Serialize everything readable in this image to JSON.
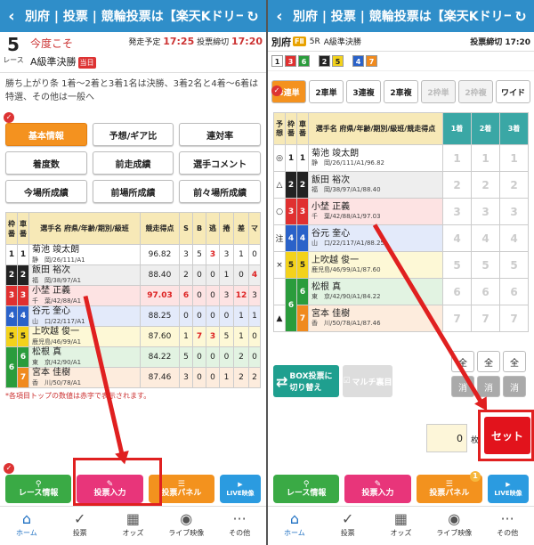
{
  "header": {
    "title": "別府 | 投票 | 競輪投票は【楽天Kドリー…"
  },
  "race": {
    "number": "5",
    "number_label": "レース",
    "name": "今度こそ",
    "grade": "A級準決勝",
    "grade_badge": "当日",
    "start_label": "発走予定",
    "start_time": "17:25",
    "close_label": "投票締切",
    "close_time": "17:20"
  },
  "conditions": "勝ち上がり条 1着〜2着と3着1名は決勝、3着2名と4着〜6着は特選、その他は一般へ",
  "tabs": [
    "基本情報",
    "予想/ギア比",
    "連対率",
    "着度数",
    "前走成績",
    "選手コメント",
    "今場所成績",
    "前場所成績",
    "前々場所成績"
  ],
  "left_table": {
    "headers": [
      "枠番",
      "車番",
      "選手名\n府県/年齢/期別/級班",
      "競走得点",
      "S",
      "B",
      "逃",
      "捲",
      "差",
      "マ"
    ],
    "rows": [
      {
        "frame": "1",
        "car": "1",
        "name": "菊池 竣太朗",
        "info": "静　岡/26/111/A1",
        "score": "96.82",
        "s": "3",
        "b": "5",
        "n": "3",
        "m": "3",
        "sa": "1",
        "ma": "0"
      },
      {
        "frame": "2",
        "car": "2",
        "name": "飯田 裕次",
        "info": "福　岡/38/97/A1",
        "score": "88.40",
        "s": "2",
        "b": "0",
        "n": "0",
        "m": "1",
        "sa": "0",
        "ma": "4"
      },
      {
        "frame": "3",
        "car": "3",
        "name": "小埜 正義",
        "info": "千　葉/42/88/A1",
        "score": "97.03",
        "s": "6",
        "b": "0",
        "n": "0",
        "m": "3",
        "sa": "12",
        "ma": "3"
      },
      {
        "frame": "4",
        "car": "4",
        "name": "谷元 奎心",
        "info": "山　口/22/117/A1",
        "score": "88.25",
        "s": "0",
        "b": "0",
        "n": "0",
        "m": "0",
        "sa": "1",
        "ma": "1"
      },
      {
        "frame": "5",
        "car": "5",
        "name": "上吹越 俊一",
        "info": "鹿児島/46/99/A1",
        "score": "87.60",
        "s": "1",
        "b": "7",
        "n": "3",
        "m": "5",
        "sa": "1",
        "ma": "0"
      },
      {
        "frame": "6",
        "car": "6",
        "name": "松根 真",
        "info": "東　京/42/90/A1",
        "score": "84.22",
        "s": "5",
        "b": "0",
        "n": "0",
        "m": "0",
        "sa": "2",
        "ma": "0"
      },
      {
        "frame": "6",
        "car": "7",
        "name": "宮本 佳樹",
        "info": "香　川/50/78/A1",
        "score": "87.46",
        "s": "3",
        "b": "0",
        "n": "0",
        "m": "1",
        "sa": "2",
        "ma": "2"
      }
    ]
  },
  "note": "*各項目トップの数値は赤字で表示されます。",
  "footer_buttons": [
    "レース情報",
    "投票入力",
    "投票パネル",
    "LIVE映像"
  ],
  "nav": [
    "ホーム",
    "投票",
    "オッズ",
    "ライブ映像",
    "その他"
  ],
  "nav_icons": [
    "home-icon",
    "vote-icon",
    "odds-icon",
    "live-icon",
    "more-icon"
  ],
  "right": {
    "venue": "別府",
    "venue_badge": "FⅡ",
    "race_label": "5R",
    "grade": "A級準決勝",
    "close_label": "投票締切",
    "close_time": "17:20",
    "lines": [
      "1",
      "3",
      "6",
      "2",
      "5",
      "4",
      "7"
    ],
    "bet_types": [
      "3連単",
      "2車単",
      "3連複",
      "2車複",
      "2枠単",
      "2枠複",
      "ワイド"
    ],
    "headers": [
      "予想",
      "枠番",
      "車番",
      "選手名\n府県/年齢/期別/級班/競走得点",
      "1着",
      "2着",
      "3着"
    ],
    "rows": [
      {
        "mark": "◎",
        "frame": "1",
        "car": "1",
        "name": "菊池 竣太朗",
        "info": "静　岡/26/111/A1/96.82"
      },
      {
        "mark": "△",
        "frame": "2",
        "car": "2",
        "name": "飯田 裕次",
        "info": "福　岡/38/97/A1/88.40"
      },
      {
        "mark": "○",
        "frame": "3",
        "car": "3",
        "name": "小埜 正義",
        "info": "千　葉/42/88/A1/97.03"
      },
      {
        "mark": "注",
        "frame": "4",
        "car": "4",
        "name": "谷元 奎心",
        "info": "山　口/22/117/A1/88.25"
      },
      {
        "mark": "×",
        "frame": "5",
        "car": "5",
        "name": "上吹越 俊一",
        "info": "鹿児島/46/99/A1/87.60"
      },
      {
        "mark": "",
        "frame": "6",
        "car": "6",
        "name": "松根 真",
        "info": "東　京/42/90/A1/84.22"
      },
      {
        "mark": "▲",
        "frame": "6",
        "car": "7",
        "name": "宮本 佳樹",
        "info": "香　川/50/78/A1/87.46"
      }
    ],
    "all_label": "全",
    "clear_label": "消",
    "box_button": "BOX投票に切り替え",
    "multi_button": "マルチ裏目",
    "ticket_value": "0",
    "ticket_unit": "枚",
    "set_button": "セット",
    "panel_badge": "1"
  },
  "colors": {
    "header": "#2f8ec9",
    "accent_orange": "#f4921f",
    "highlight_red": "#e02020"
  }
}
